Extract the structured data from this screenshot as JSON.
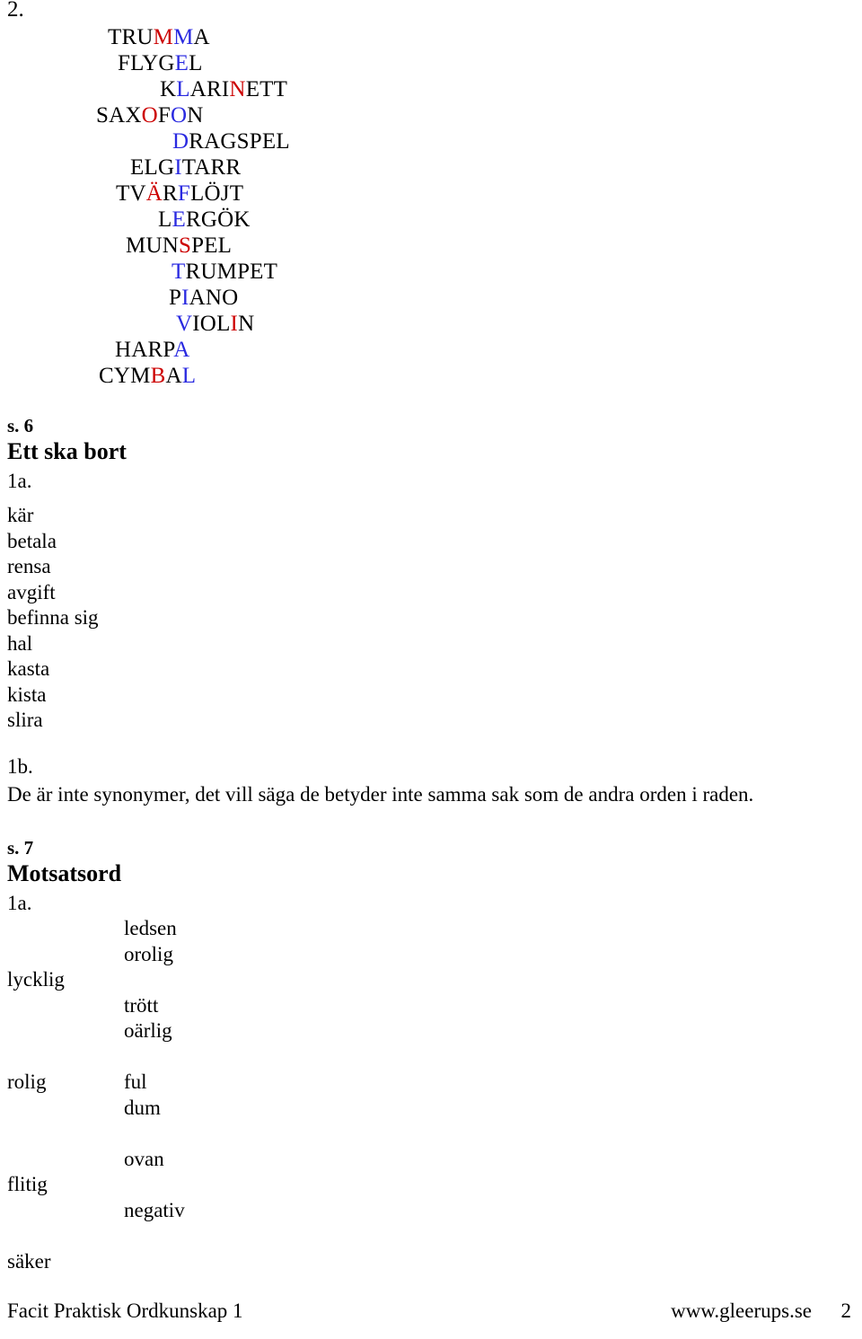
{
  "colors": {
    "text": "#000000",
    "red": "#CC0000",
    "blue": "#2A2AE0",
    "background": "#FFFFFF"
  },
  "exercise_2": {
    "number": "2.",
    "instruments": [
      {
        "text": "TRUMMA",
        "indent": 120,
        "letters": [
          {
            "i": 3,
            "color": "red"
          },
          {
            "i": 4,
            "color": "blue"
          }
        ]
      },
      {
        "text": "FLYGEL",
        "indent": 131,
        "letters": [
          {
            "i": 4,
            "color": "blue"
          }
        ]
      },
      {
        "text": "KLARINETT",
        "indent": 178,
        "letters": [
          {
            "i": 1,
            "color": "blue"
          },
          {
            "i": 5,
            "color": "red"
          }
        ]
      },
      {
        "text": "SAXOFON",
        "indent": 107,
        "letters": [
          {
            "i": 3,
            "color": "red"
          },
          {
            "i": 5,
            "color": "blue"
          }
        ]
      },
      {
        "text": "DRAGSPEL",
        "indent": 192,
        "letters": [
          {
            "i": 0,
            "color": "blue"
          }
        ]
      },
      {
        "text": "ELGITARR",
        "indent": 145,
        "letters": [
          {
            "i": 3,
            "color": "blue"
          }
        ]
      },
      {
        "text": "TVÄRFLÖJT",
        "indent": 129,
        "letters": [
          {
            "i": 2,
            "color": "red"
          },
          {
            "i": 4,
            "color": "blue"
          }
        ]
      },
      {
        "text": "LERGÖK",
        "indent": 176,
        "letters": [
          {
            "i": 1,
            "color": "blue"
          }
        ]
      },
      {
        "text": "MUNSPEL",
        "indent": 140,
        "letters": [
          {
            "i": 3,
            "color": "red"
          }
        ]
      },
      {
        "text": "TRUMPET",
        "indent": 191,
        "letters": [
          {
            "i": 0,
            "color": "blue"
          }
        ]
      },
      {
        "text": "PIANO",
        "indent": 188,
        "letters": [
          {
            "i": 1,
            "color": "blue"
          }
        ]
      },
      {
        "text": "VIOLIN",
        "indent": 196,
        "letters": [
          {
            "i": 0,
            "color": "blue"
          },
          {
            "i": 4,
            "color": "red"
          }
        ]
      },
      {
        "text": "HARPA",
        "indent": 128,
        "letters": [
          {
            "i": 4,
            "color": "blue"
          }
        ]
      },
      {
        "text": "CYMBAL",
        "indent": 110,
        "letters": [
          {
            "i": 3,
            "color": "red"
          },
          {
            "i": 5,
            "color": "blue"
          }
        ]
      }
    ]
  },
  "section_s6": {
    "page_ref": "s. 6",
    "title": "Ett ska bort",
    "item_a_label": "1a.",
    "words": [
      "kär",
      "betala",
      "rensa",
      "avgift",
      "befinna sig",
      "hal",
      "kasta",
      "kista",
      "slira"
    ],
    "item_b_label": "1b.",
    "item_b_text": "De är inte synonymer, det vill säga de betyder inte samma sak som de andra orden i raden."
  },
  "section_s7": {
    "page_ref": "s. 7",
    "title": "Motsatsord",
    "item_a_label": "1a.",
    "left_column": [
      "lycklig",
      "rolig",
      "flitig",
      "säker"
    ],
    "right_column": [
      "ledsen",
      "orolig",
      "trött",
      "oärlig",
      "ful",
      "dum",
      "ovan",
      "negativ"
    ]
  },
  "footer": {
    "left": "Facit Praktisk Ordkunskap 1",
    "url": "www.gleerups.se",
    "page_number": "2"
  }
}
